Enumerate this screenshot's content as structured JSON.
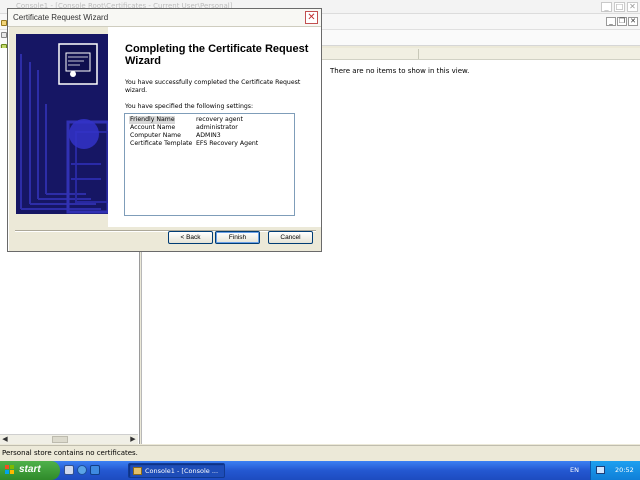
{
  "console": {
    "title": "Console1 - [Console Root\\Certificates - Current User\\Personal]",
    "empty_message": "There are no items to show in this view.",
    "status_text": "Personal store contains no certificates.",
    "minimize": "_",
    "maximize": "□",
    "close": "✕",
    "inner_minimize": "_",
    "inner_restore": "❐",
    "inner_close": "✕"
  },
  "wizard": {
    "title": "Certificate Request Wizard",
    "heading": "Completing the Certificate Request Wizard",
    "description": "You have successfully completed the Certificate Request wizard.",
    "settings_intro": "You have specified the following settings:",
    "settings": [
      {
        "key": "Friendly Name",
        "value": "recovery agent"
      },
      {
        "key": "Account Name",
        "value": "administrator"
      },
      {
        "key": "Computer Name",
        "value": "ADMIN3"
      },
      {
        "key": "Certificate Template",
        "value": "EFS Recovery Agent"
      }
    ],
    "back_label": "< Back",
    "finish_label": "Finish",
    "cancel_label": "Cancel",
    "close_label": "✕"
  },
  "taskbar": {
    "start_label": "start",
    "task_label": "Console1 - [Console ...",
    "language": "EN",
    "clock": "20:52"
  },
  "colors": {
    "banner": "#1a1a6e",
    "taskbar": "#2458d1",
    "start": "#3a9a34",
    "tray": "#0f7fd8"
  }
}
